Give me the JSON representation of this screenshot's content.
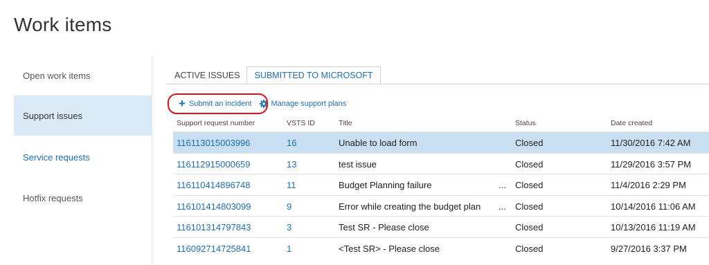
{
  "page": {
    "title": "Work items"
  },
  "sidebar": {
    "items": [
      {
        "label": "Open work items"
      },
      {
        "label": "Support issues"
      },
      {
        "label": "Service requests"
      },
      {
        "label": "Hotfix requests"
      }
    ]
  },
  "tabs": [
    {
      "label": "ACTIVE ISSUES"
    },
    {
      "label": "SUBMITTED TO MICROSOFT"
    }
  ],
  "toolbar": {
    "submit_label": "Submit an incident",
    "manage_label": "Manage support plans"
  },
  "table": {
    "headers": {
      "number": "Support request number",
      "vsts": "VSTS ID",
      "title": "Title",
      "status": "Status",
      "date": "Date created"
    },
    "rows": [
      {
        "number": "116113015003996",
        "vsts": "16",
        "title": "Unable to load form",
        "ellipsis": "",
        "status": "Closed",
        "date": "11/30/2016 7:42 AM"
      },
      {
        "number": "116112915000659",
        "vsts": "13",
        "title": "test issue",
        "ellipsis": "",
        "status": "Closed",
        "date": "11/29/2016 3:57 PM"
      },
      {
        "number": "116110414896748",
        "vsts": "11",
        "title": "Budget Planning failure",
        "ellipsis": "...",
        "status": "Closed",
        "date": "11/4/2016 2:29 PM"
      },
      {
        "number": "116101414803099",
        "vsts": "9",
        "title": "Error while creating the budget plan",
        "ellipsis": "...",
        "status": "Closed",
        "date": "10/14/2016 11:06 AM"
      },
      {
        "number": "116101314797843",
        "vsts": "3",
        "title": "Test SR - Please close",
        "ellipsis": "",
        "status": "Closed",
        "date": "10/13/2016 11:19 AM"
      },
      {
        "number": "116092714725841",
        "vsts": "1",
        "title": "<Test SR>  - Please close",
        "ellipsis": "",
        "status": "Closed",
        "date": "9/27/2016 3:37 PM"
      }
    ]
  },
  "colors": {
    "accent": "#1e6eb5",
    "selected_row": "#c9dff2",
    "active_sidebar": "#daeaf7",
    "annotation_circle": "#d9131a"
  }
}
